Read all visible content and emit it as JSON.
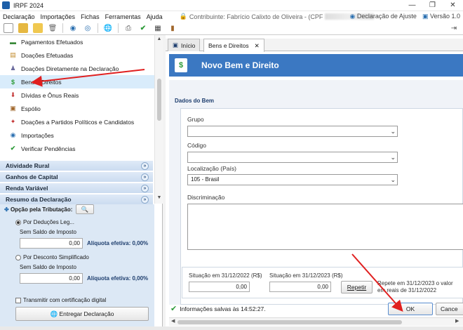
{
  "window": {
    "title": "IRPF 2024",
    "controls": [
      "—",
      "❐",
      "✕"
    ]
  },
  "menu": {
    "items": [
      "Declaração",
      "Importações",
      "Fichas",
      "Ferramentas",
      "Ajuda"
    ],
    "contributor": "Contribuinte: Fabrício Calixto de Oliveira - (CPF",
    "declaration_type": "Declaração de Ajuste",
    "version": "Versão 1.0"
  },
  "sidebar": {
    "items": [
      {
        "label": "Pagamentos Efetuados",
        "icon": "payment-icon",
        "glyph": "▬",
        "color": "#3a8a3a"
      },
      {
        "label": "Doações Efetuadas",
        "icon": "donation-icon",
        "glyph": "▤",
        "color": "#c08a2a"
      },
      {
        "label": "Doações Diretamente na Declaração",
        "icon": "direct-donation-icon",
        "glyph": "♟",
        "color": "#6b6b9e"
      },
      {
        "label": "Bens e Direitos",
        "icon": "assets-icon",
        "glyph": "$",
        "color": "#2e9b3a"
      },
      {
        "label": "Dívidas e Ônus Reais",
        "icon": "debts-icon",
        "glyph": "⬇",
        "color": "#c23030"
      },
      {
        "label": "Espólio",
        "icon": "estate-icon",
        "glyph": "▣",
        "color": "#a0662a"
      },
      {
        "label": "Doações a Partidos Políticos e Candidatos",
        "icon": "political-donation-icon",
        "glyph": "✦",
        "color": "#c23030"
      },
      {
        "label": "Importações",
        "icon": "import-icon",
        "glyph": "◉",
        "color": "#2a6fb0"
      },
      {
        "label": "Verificar Pendências",
        "icon": "check-icon",
        "glyph": "✔",
        "color": "#2e9b3a"
      }
    ],
    "sections": [
      "Atividade Rural",
      "Ganhos de Capital",
      "Renda Variável",
      "Resumo da Declaração"
    ],
    "summary": {
      "tax_option_label": "Opção pela Tributação:",
      "legal_deductions": "Por Deduções Leg...",
      "no_tax_balance": "Sem Saldo de Imposto",
      "legal_value": "0,00",
      "effective_rate": "Alíquota efetiva: 0,00%",
      "simplified": "Por Desconto Simplificado",
      "no_tax_balance2": "Sem Saldo de Imposto",
      "simplified_value": "0,00",
      "effective_rate2": "Alíquota efetiva: 0,00%",
      "transmit_cert": "Transmitir com certificação digital",
      "deliver_button": "Entregar Declaração"
    }
  },
  "tabs": [
    {
      "label": "Início"
    },
    {
      "label": "Bens e Direitos"
    }
  ],
  "form": {
    "header_title": "Novo Bem e Direito",
    "section_title": "Dados do Bem",
    "group_label": "Grupo",
    "group_value": "",
    "code_label": "Código",
    "code_value": "",
    "location_label": "Localização (País)",
    "location_value": "105 - Brasil",
    "discrimination_label": "Discriminação",
    "situation_2022_label": "Situação em 31/12/2022 (R$)",
    "situation_2022_value": "0,00",
    "situation_2023_label": "Situação em 31/12/2023 (R$)",
    "situation_2023_value": "0,00",
    "repeat_button": "Repetir",
    "repeat_note_1": "Repete em 31/12/2023 o valor",
    "repeat_note_2": "em reais de 31/12/2022"
  },
  "footer": {
    "saved_info": "Informações salvas às 14:52:27.",
    "ok_button": "OK",
    "cancel_button": "Cance"
  },
  "colors": {
    "accent": "#3b78c2",
    "annotation_arrow": "#e02020"
  }
}
